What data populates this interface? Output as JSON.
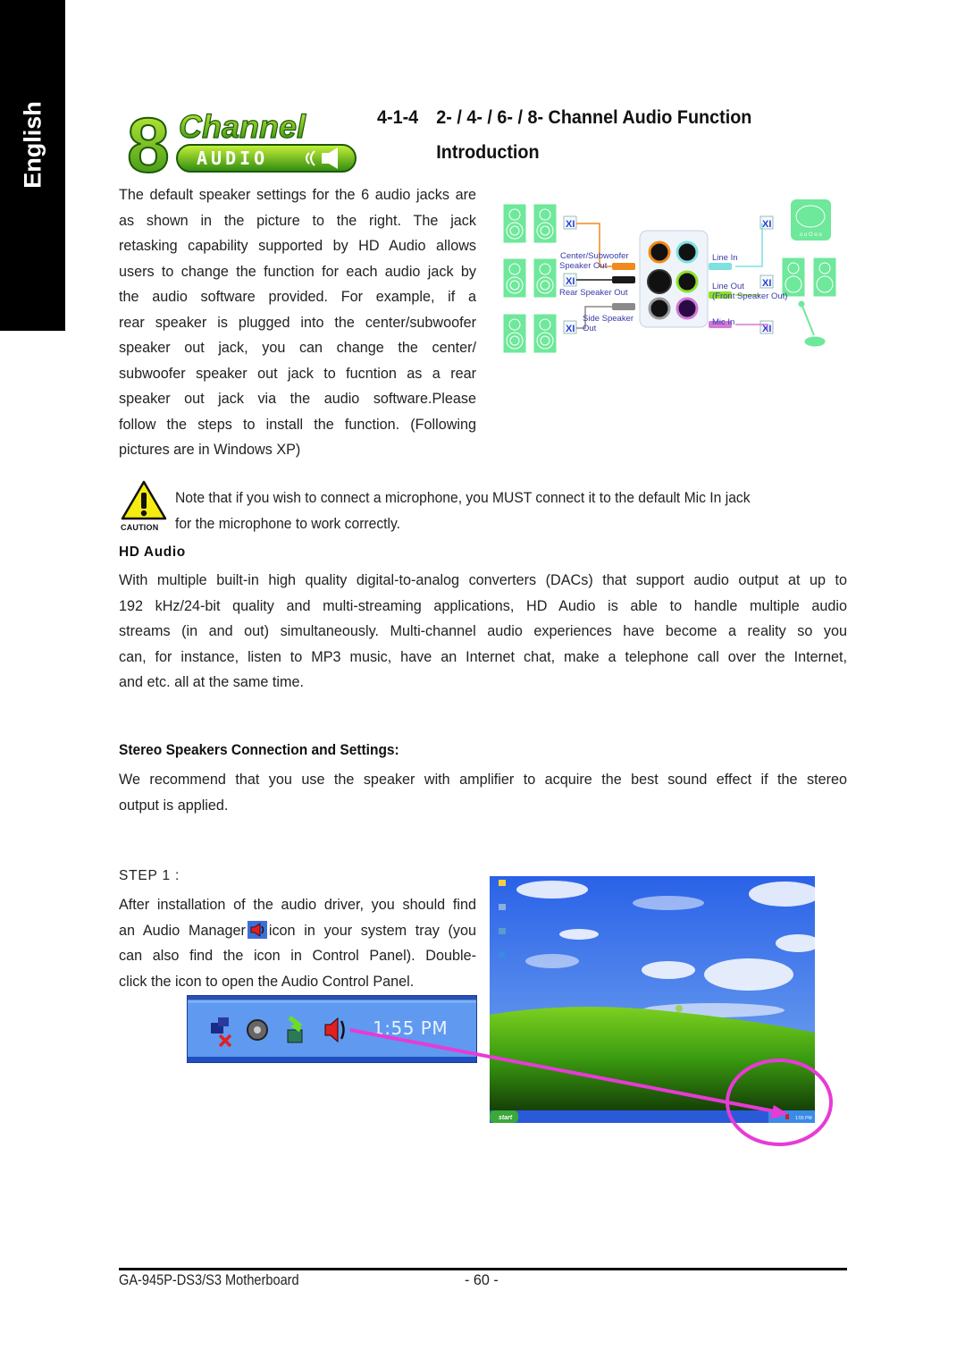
{
  "language_tab": "English",
  "logo": {
    "line1": "8 Channel",
    "line2": "AUDIO"
  },
  "heading": {
    "number": "4-1-4",
    "title_line1": "2- / 4- / 6- / 8- Channel Audio Function",
    "title_line2": "Introduction"
  },
  "intro_lines": [
    "The default speaker settings for the 6 audio jacks are",
    "as shown in the picture to the right. The jack",
    "retasking capability supported by HD Audio allows",
    "users to change the function for each audio jack by",
    "the audio software provided. For example, if  a",
    "rear speaker is plugged into the center/subwoofer",
    "speaker out jack, you can change the center/",
    "subwoofer speaker out jack to fucntion as a rear",
    "speaker out jack via the audio software.Please",
    "follow the steps to install the function. (Following",
    "pictures are in Windows XP)"
  ],
  "jack_diagram": {
    "labels": {
      "center_subwoofer_1": "Center/Subwoofer",
      "center_subwoofer_2": "Speaker Out",
      "rear_speaker": "Rear Speaker Out",
      "side_speaker_1": "Side Speaker",
      "side_speaker_2": "Out",
      "line_in": "Line In",
      "line_out_1": "Line Out",
      "line_out_2": "(Front Speaker Out)",
      "mic_in": "Mic In"
    },
    "colors": {
      "center_subwoofer": "#f08a1c",
      "rear_speaker": "#1a1a1a",
      "side_speaker": "#8a8a8a",
      "line_in": "#7fe0e0",
      "line_out": "#8ee02a",
      "mic_in": "#d27ad6",
      "speaker_body": "#6ee89a"
    }
  },
  "caution": {
    "icon_label": "CAUTION",
    "line1": "Note that if you wish to connect a microphone, you MUST connect it to the default Mic In jack",
    "line2": "for the microphone to work correctly."
  },
  "hd_audio": {
    "title": "HD Audio",
    "lines": [
      "With multiple built-in high quality digital-to-analog converters (DACs) that support audio output at up to",
      "192 kHz/24-bit quality and multi-streaming applications, HD Audio is able to handle multiple audio",
      "streams (in and out) simultaneously. Multi-channel audio experiences have become a reality so you",
      "can, for instance,  listen to MP3 music, have an Internet chat, make a telephone call over the Internet,",
      "and etc. all at the same time."
    ]
  },
  "stereo": {
    "title": "Stereo Speakers Connection and Settings:",
    "lines": [
      "We recommend that you use the speaker with amplifier to acquire the best sound effect if the stereo",
      "output is applied."
    ]
  },
  "step1": {
    "title": "STEP 1 :",
    "line1": "After installation of the audio driver, you should find",
    "line2_before": "an Audio Manager",
    "line2_after": "icon in your system tray (you",
    "line3": "can also find the icon in Control Panel).  Double-",
    "line4": "click the icon to open the Audio Control Panel."
  },
  "tray": {
    "time": "1:55 PM"
  },
  "desktop": {
    "start_label": "start",
    "taskbar_time": "1:55 PM",
    "highlight_color": "#e83ad6"
  },
  "footer": {
    "model": "GA-945P-DS3/S3 Motherboard",
    "page": "- 60 -"
  }
}
